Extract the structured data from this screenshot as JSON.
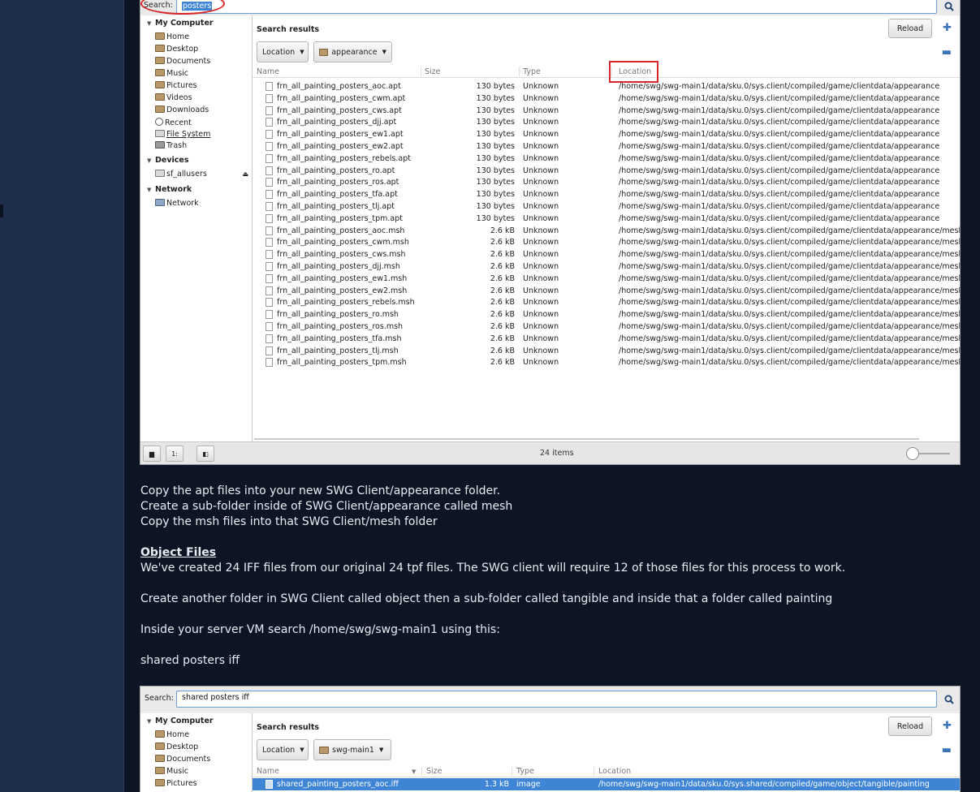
{
  "fm1": {
    "search_label": "Search:",
    "search_value": "posters",
    "sidebar": {
      "my_computer": "My Computer",
      "items": [
        "Home",
        "Desktop",
        "Documents",
        "Music",
        "Pictures",
        "Videos",
        "Downloads",
        "Recent",
        "File System",
        "Trash"
      ],
      "devices": "Devices",
      "device_items": [
        "sf_allusers"
      ],
      "network": "Network",
      "network_items": [
        "Network"
      ]
    },
    "results_title": "Search results",
    "reload_label": "Reload",
    "location_dropdown": "Location",
    "folder_dropdown": "appearance",
    "columns": {
      "name": "Name",
      "size": "Size",
      "type": "Type",
      "location": "Location"
    },
    "rows": [
      {
        "name": "frn_all_painting_posters_aoc.apt",
        "size": "130 bytes",
        "type": "Unknown",
        "location": "/home/swg/swg-main1/data/sku.0/sys.client/compiled/game/clientdata/appearance"
      },
      {
        "name": "frn_all_painting_posters_cwm.apt",
        "size": "130 bytes",
        "type": "Unknown",
        "location": "/home/swg/swg-main1/data/sku.0/sys.client/compiled/game/clientdata/appearance"
      },
      {
        "name": "frn_all_painting_posters_cws.apt",
        "size": "130 bytes",
        "type": "Unknown",
        "location": "/home/swg/swg-main1/data/sku.0/sys.client/compiled/game/clientdata/appearance"
      },
      {
        "name": "frn_all_painting_posters_djj.apt",
        "size": "130 bytes",
        "type": "Unknown",
        "location": "/home/swg/swg-main1/data/sku.0/sys.client/compiled/game/clientdata/appearance"
      },
      {
        "name": "frn_all_painting_posters_ew1.apt",
        "size": "130 bytes",
        "type": "Unknown",
        "location": "/home/swg/swg-main1/data/sku.0/sys.client/compiled/game/clientdata/appearance"
      },
      {
        "name": "frn_all_painting_posters_ew2.apt",
        "size": "130 bytes",
        "type": "Unknown",
        "location": "/home/swg/swg-main1/data/sku.0/sys.client/compiled/game/clientdata/appearance"
      },
      {
        "name": "frn_all_painting_posters_rebels.apt",
        "size": "130 bytes",
        "type": "Unknown",
        "location": "/home/swg/swg-main1/data/sku.0/sys.client/compiled/game/clientdata/appearance"
      },
      {
        "name": "frn_all_painting_posters_ro.apt",
        "size": "130 bytes",
        "type": "Unknown",
        "location": "/home/swg/swg-main1/data/sku.0/sys.client/compiled/game/clientdata/appearance"
      },
      {
        "name": "frn_all_painting_posters_ros.apt",
        "size": "130 bytes",
        "type": "Unknown",
        "location": "/home/swg/swg-main1/data/sku.0/sys.client/compiled/game/clientdata/appearance"
      },
      {
        "name": "frn_all_painting_posters_tfa.apt",
        "size": "130 bytes",
        "type": "Unknown",
        "location": "/home/swg/swg-main1/data/sku.0/sys.client/compiled/game/clientdata/appearance"
      },
      {
        "name": "frn_all_painting_posters_tlj.apt",
        "size": "130 bytes",
        "type": "Unknown",
        "location": "/home/swg/swg-main1/data/sku.0/sys.client/compiled/game/clientdata/appearance"
      },
      {
        "name": "frn_all_painting_posters_tpm.apt",
        "size": "130 bytes",
        "type": "Unknown",
        "location": "/home/swg/swg-main1/data/sku.0/sys.client/compiled/game/clientdata/appearance"
      },
      {
        "name": "frn_all_painting_posters_aoc.msh",
        "size": "2.6 kB",
        "type": "Unknown",
        "location": "/home/swg/swg-main1/data/sku.0/sys.client/compiled/game/clientdata/appearance/mesh"
      },
      {
        "name": "frn_all_painting_posters_cwm.msh",
        "size": "2.6 kB",
        "type": "Unknown",
        "location": "/home/swg/swg-main1/data/sku.0/sys.client/compiled/game/clientdata/appearance/mesh"
      },
      {
        "name": "frn_all_painting_posters_cws.msh",
        "size": "2.6 kB",
        "type": "Unknown",
        "location": "/home/swg/swg-main1/data/sku.0/sys.client/compiled/game/clientdata/appearance/mesh"
      },
      {
        "name": "frn_all_painting_posters_djj.msh",
        "size": "2.6 kB",
        "type": "Unknown",
        "location": "/home/swg/swg-main1/data/sku.0/sys.client/compiled/game/clientdata/appearance/mesh"
      },
      {
        "name": "frn_all_painting_posters_ew1.msh",
        "size": "2.6 kB",
        "type": "Unknown",
        "location": "/home/swg/swg-main1/data/sku.0/sys.client/compiled/game/clientdata/appearance/mesh"
      },
      {
        "name": "frn_all_painting_posters_ew2.msh",
        "size": "2.6 kB",
        "type": "Unknown",
        "location": "/home/swg/swg-main1/data/sku.0/sys.client/compiled/game/clientdata/appearance/mesh"
      },
      {
        "name": "frn_all_painting_posters_rebels.msh",
        "size": "2.6 kB",
        "type": "Unknown",
        "location": "/home/swg/swg-main1/data/sku.0/sys.client/compiled/game/clientdata/appearance/mesh"
      },
      {
        "name": "frn_all_painting_posters_ro.msh",
        "size": "2.6 kB",
        "type": "Unknown",
        "location": "/home/swg/swg-main1/data/sku.0/sys.client/compiled/game/clientdata/appearance/mesh"
      },
      {
        "name": "frn_all_painting_posters_ros.msh",
        "size": "2.6 kB",
        "type": "Unknown",
        "location": "/home/swg/swg-main1/data/sku.0/sys.client/compiled/game/clientdata/appearance/mesh"
      },
      {
        "name": "frn_all_painting_posters_tfa.msh",
        "size": "2.6 kB",
        "type": "Unknown",
        "location": "/home/swg/swg-main1/data/sku.0/sys.client/compiled/game/clientdata/appearance/mesh"
      },
      {
        "name": "frn_all_painting_posters_tlj.msh",
        "size": "2.6 kB",
        "type": "Unknown",
        "location": "/home/swg/swg-main1/data/sku.0/sys.client/compiled/game/clientdata/appearance/mesh"
      },
      {
        "name": "frn_all_painting_posters_tpm.msh",
        "size": "2.6 kB",
        "type": "Unknown",
        "location": "/home/swg/swg-main1/data/sku.0/sys.client/compiled/game/clientdata/appearance/mesh"
      }
    ],
    "status_text": "24 items"
  },
  "article": {
    "lines": [
      "Copy the apt files into your new SWG Client/appearance folder.",
      "Create a sub-folder inside of SWG Client/appearance called mesh",
      "Copy the msh files into that SWG Client/mesh folder"
    ],
    "object_files_heading": "Object Files",
    "object_files_text": "We've created 24 IFF files from our original 24 tpf files. The SWG client will require 12 of those files for this process to work.",
    "create_folder_text": "Create another folder in SWG Client called object then a sub-folder called tangible and inside that a folder called painting",
    "inside_vm_text": "Inside your server VM search /home/swg/swg-main1 using this:",
    "search_term": "shared posters iff"
  },
  "fm2": {
    "search_label": "Search:",
    "search_value": "shared posters iff",
    "sidebar": {
      "my_computer": "My Computer",
      "items": [
        "Home",
        "Desktop",
        "Documents",
        "Music",
        "Pictures"
      ]
    },
    "results_title": "Search results",
    "reload_label": "Reload",
    "location_dropdown": "Location",
    "folder_dropdown": "swg-main1",
    "columns": {
      "name": "Name",
      "size": "Size",
      "type": "Type",
      "location": "Location"
    },
    "rows": [
      {
        "name": "shared_painting_posters_aoc.iff",
        "size": "1.3 kB",
        "type": "image",
        "location": "/home/swg/swg-main1/data/sku.0/sys.shared/compiled/game/object/tangible/painting"
      }
    ]
  },
  "colors": {
    "page_bg": "#0d1524",
    "rail_bg": "#1f2e4a",
    "annotation_red": "#d6262a",
    "selection_blue": "#3f85d6",
    "text_light": "#e8ecf2"
  }
}
